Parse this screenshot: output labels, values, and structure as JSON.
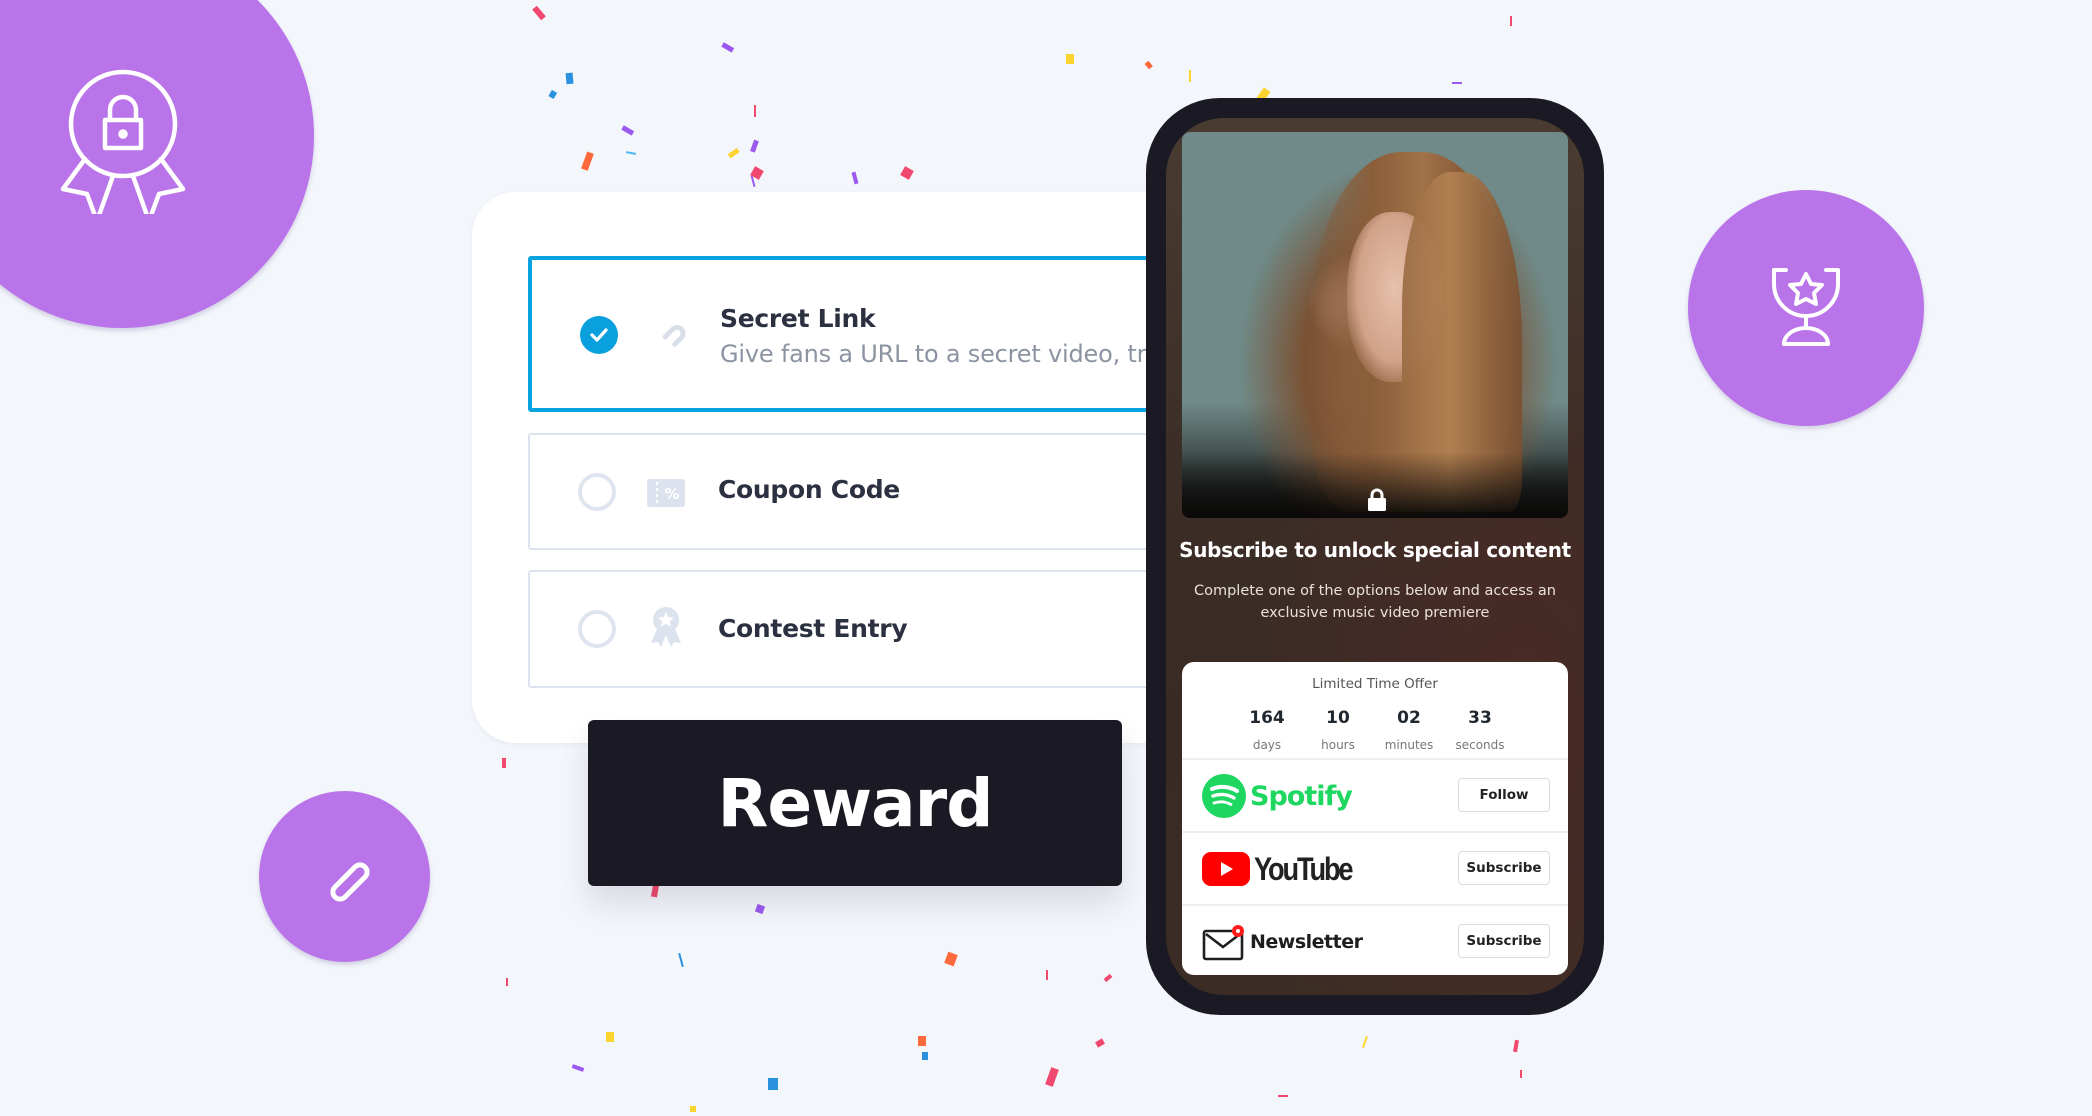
{
  "background_color": "#f3f6fb",
  "accent_purple": "#b974ea",
  "reward_types": {
    "options": [
      {
        "title": "Secret Link",
        "description": "Give fans a URL to a secret video, tr",
        "selected": true,
        "icon": "link-icon"
      },
      {
        "title": "Coupon Code",
        "description": "",
        "selected": false,
        "icon": "coupon-icon"
      },
      {
        "title": "Contest Entry",
        "description": "",
        "selected": false,
        "icon": "award-ribbon-icon"
      }
    ],
    "selected_color": "#0aa3e0"
  },
  "reward_button": {
    "label": "Reward"
  },
  "decorative_badges": [
    {
      "icon": "lock-badge-icon"
    },
    {
      "icon": "trophy-star-icon"
    },
    {
      "icon": "link-icon"
    }
  ],
  "phone": {
    "locked_icon": "lock-icon",
    "title": "Subscribe to unlock special content",
    "description": "Complete one of the options below and access an exclusive music video premiere",
    "offer": {
      "title": "Limited Time Offer",
      "countdown": [
        {
          "value": "164",
          "unit": "days"
        },
        {
          "value": "10",
          "unit": "hours"
        },
        {
          "value": "02",
          "unit": "minutes"
        },
        {
          "value": "33",
          "unit": "seconds"
        }
      ],
      "actions": [
        {
          "brand": "Spotify",
          "button": "Follow",
          "color": "#1ed760"
        },
        {
          "brand": "YouTube",
          "button": "Subscribe",
          "color": "#ff0000"
        },
        {
          "brand": "Newsletter",
          "button": "Subscribe",
          "color": "#ff1a1a"
        }
      ]
    }
  }
}
